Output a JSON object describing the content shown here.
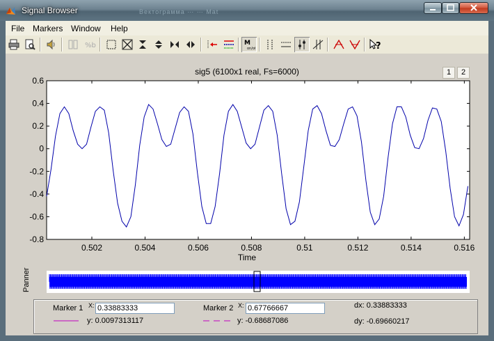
{
  "window": {
    "title": "Signal Browser",
    "ghost_title": "Вектограмма ⋯  ⋯  Mat"
  },
  "menu": {
    "items": [
      "File",
      "Markers",
      "Window",
      "Help"
    ]
  },
  "toolbar": {
    "buttons": [
      "print-icon",
      "print-preview-icon",
      "play-icon",
      "link-icon",
      "select-icon",
      "zoom-box-icon",
      "zoom-full-icon",
      "zoom-y-in-icon",
      "zoom-y-out-icon",
      "zoom-x-in-icon",
      "zoom-x-out-icon",
      "select-trace-icon",
      "array-signal-icon",
      "markers-toggle-icon",
      "vertical-markers-icon",
      "horizontal-markers-icon",
      "track-markers-icon",
      "slope-markers-icon",
      "peaks-icon",
      "valleys-icon",
      "whats-this-icon"
    ]
  },
  "plot": {
    "title": "sig5 (6100x1 real, Fs=6000)",
    "xlabel": "Time",
    "page_buttons": [
      "1",
      "2"
    ],
    "panner_label": "Panner"
  },
  "chart_data": {
    "type": "line",
    "title": "sig5 (6100x1 real, Fs=6000)",
    "xlabel": "Time",
    "ylabel": "",
    "xlim": [
      0.5003,
      0.5162
    ],
    "ylim": [
      -0.8,
      0.6
    ],
    "yticks": [
      0.6,
      0.4,
      0.2,
      0,
      -0.2,
      -0.4,
      -0.6,
      -0.8
    ],
    "ytick_labels": [
      "0.6",
      "0.4",
      "0.2",
      "0",
      "-0.2",
      "-0.4",
      "-0.6",
      "-0.8"
    ],
    "xticks": [
      0.502,
      0.504,
      0.506,
      0.508,
      0.51,
      0.512,
      0.514,
      0.516
    ],
    "xtick_labels": [
      "0.502",
      "0.504",
      "0.506",
      "0.508",
      "0.51",
      "0.512",
      "0.514",
      "0.516"
    ],
    "grid": false,
    "color": "#0000aa",
    "series": [
      {
        "x0": 0.5003,
        "dx": 0.0001666667,
        "values": [
          -0.42,
          -0.18,
          0.11,
          0.31,
          0.37,
          0.31,
          0.16,
          0.04,
          0.0,
          0.04,
          0.19,
          0.33,
          0.37,
          0.34,
          0.14,
          -0.19,
          -0.48,
          -0.64,
          -0.69,
          -0.6,
          -0.32,
          0.03,
          0.28,
          0.39,
          0.35,
          0.22,
          0.08,
          0.02,
          0.04,
          0.18,
          0.32,
          0.37,
          0.33,
          0.13,
          -0.21,
          -0.51,
          -0.66,
          -0.66,
          -0.51,
          -0.22,
          0.12,
          0.33,
          0.39,
          0.33,
          0.19,
          0.05,
          0.0,
          0.04,
          0.19,
          0.34,
          0.38,
          0.33,
          0.12,
          -0.22,
          -0.53,
          -0.67,
          -0.64,
          -0.47,
          -0.16,
          0.16,
          0.35,
          0.38,
          0.31,
          0.16,
          0.03,
          0.02,
          0.08,
          0.22,
          0.35,
          0.37,
          0.29,
          0.06,
          -0.28,
          -0.56,
          -0.67,
          -0.62,
          -0.42,
          -0.08,
          0.22,
          0.37,
          0.37,
          0.28,
          0.12,
          0.01,
          0.0,
          0.09,
          0.25,
          0.36,
          0.35,
          0.24,
          -0.02,
          -0.35,
          -0.6,
          -0.68,
          -0.58,
          -0.33,
          -0.01,
          0.26,
          0.38,
          0.35,
          0.23,
          0.09,
          0.11
        ],
        "tail": [
          0.23
        ]
      }
    ],
    "panner": {
      "type": "dense-line",
      "color": "#0000ff",
      "window_fraction": [
        0.49,
        0.505
      ]
    }
  },
  "markers": {
    "marker1": {
      "label": "Marker 1",
      "x_prefix": "X:",
      "x": "0.33883333",
      "y_text": "y: 0.0097313117"
    },
    "marker2": {
      "label": "Marker 2",
      "x_prefix": "X:",
      "x": "0.67766667",
      "y_text": "y: -0.68687086"
    },
    "dx_text": "dx: 0.33883333",
    "dy_text": "dy: -0.69660217"
  }
}
